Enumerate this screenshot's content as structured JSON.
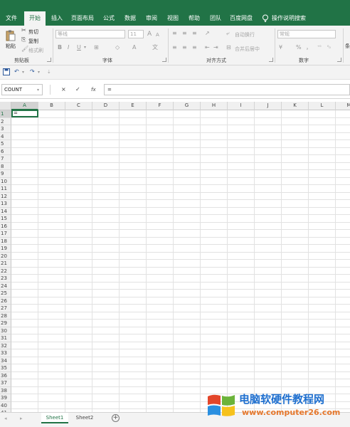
{
  "menu": {
    "tabs": [
      {
        "label": "文件"
      },
      {
        "label": "开始",
        "active": true
      },
      {
        "label": "插入"
      },
      {
        "label": "页面布局"
      },
      {
        "label": "公式"
      },
      {
        "label": "数据"
      },
      {
        "label": "审阅"
      },
      {
        "label": "视图"
      },
      {
        "label": "帮助"
      },
      {
        "label": "团队"
      },
      {
        "label": "百度网盘"
      }
    ],
    "tell_me": "操作说明搜索"
  },
  "ribbon": {
    "clipboard": {
      "paste": "粘贴",
      "cut": "剪切",
      "copy": "复制",
      "format_painter": "格式刷",
      "label": "剪贴板"
    },
    "font": {
      "font_name": "等线",
      "font_size": "11",
      "label": "字体",
      "bold": "B",
      "italic": "I",
      "underline": "U",
      "grow": "A",
      "shrink": "A"
    },
    "alignment": {
      "wrap_text": "自动换行",
      "merge_center": "合并后居中",
      "label": "对齐方式"
    },
    "number": {
      "format": "常规",
      "percent": "%",
      "label": "数字",
      "comma": "，"
    },
    "styles": {
      "conditional": "条件"
    }
  },
  "formula_bar": {
    "name_box": "COUNT",
    "cancel": "×",
    "enter": "✓",
    "fx": "fx",
    "content": "="
  },
  "grid": {
    "columns": [
      "A",
      "B",
      "C",
      "D",
      "E",
      "F",
      "G",
      "H",
      "I",
      "J",
      "K",
      "L",
      "M"
    ],
    "rows": [
      "1",
      "2",
      "3",
      "4",
      "5",
      "6",
      "7",
      "8",
      "9",
      "10",
      "11",
      "12",
      "13",
      "14",
      "15",
      "16",
      "17",
      "18",
      "19",
      "20",
      "21",
      "22",
      "23",
      "24",
      "25",
      "26",
      "27",
      "28",
      "29",
      "30",
      "31",
      "32",
      "33",
      "34",
      "35",
      "36",
      "37",
      "38",
      "39",
      "40",
      "41"
    ],
    "active_cell": {
      "ref": "A1",
      "value": "="
    }
  },
  "sheets": {
    "tabs": [
      {
        "label": "Sheet1",
        "active": true
      },
      {
        "label": "Sheet2"
      }
    ],
    "add": "+"
  },
  "watermark": {
    "title": "电脑软硬件教程网",
    "url": "www.computer26.com"
  },
  "colors": {
    "accent": "#217346",
    "ribbon_bg": "#f3f3f3"
  }
}
